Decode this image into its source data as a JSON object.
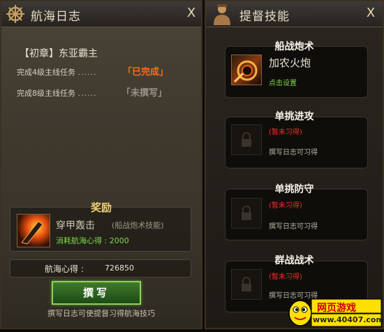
{
  "log_panel": {
    "title": "航海日志",
    "close": "X",
    "chapter": "【初章】东亚霸主",
    "tasks": [
      {
        "label": "完成4级主线任务",
        "dots": "......",
        "status": "「已完成」"
      },
      {
        "label": "完成8级主线任务",
        "dots": "......",
        "status": "「未撰写」"
      }
    ],
    "reward": {
      "title": "奖励",
      "name": "穿甲轰击",
      "type": "(船战炮术技能)",
      "cost": "消耗航海心得 : 2000"
    },
    "points_label": "航海心得 :",
    "points_value": "726850",
    "write_button": "撰写",
    "footer_hint": "撰写日志可使提督习得航海技巧"
  },
  "skill_panel": {
    "title": "提督技能",
    "close": "X",
    "skills": [
      {
        "category": "船战炮术",
        "name": "加农火炮",
        "action": "点击设置"
      },
      {
        "category": "单挑进攻",
        "status": "(暂未习得)",
        "hint": "撰写日志可习得"
      },
      {
        "category": "单挑防守",
        "status": "(暂未习得)",
        "hint": "撰写日志可习得"
      },
      {
        "category": "群战战术",
        "status": "(暂未习得)",
        "hint": "撰写日志可习得"
      }
    ]
  },
  "watermark": {
    "brand": "网页游戏",
    "url": "www.40407.com"
  },
  "colors": {
    "done": "#ff6a1a",
    "locked": "#ff2a2a",
    "action": "#7fd84a",
    "reward_title": "#f0d070"
  }
}
